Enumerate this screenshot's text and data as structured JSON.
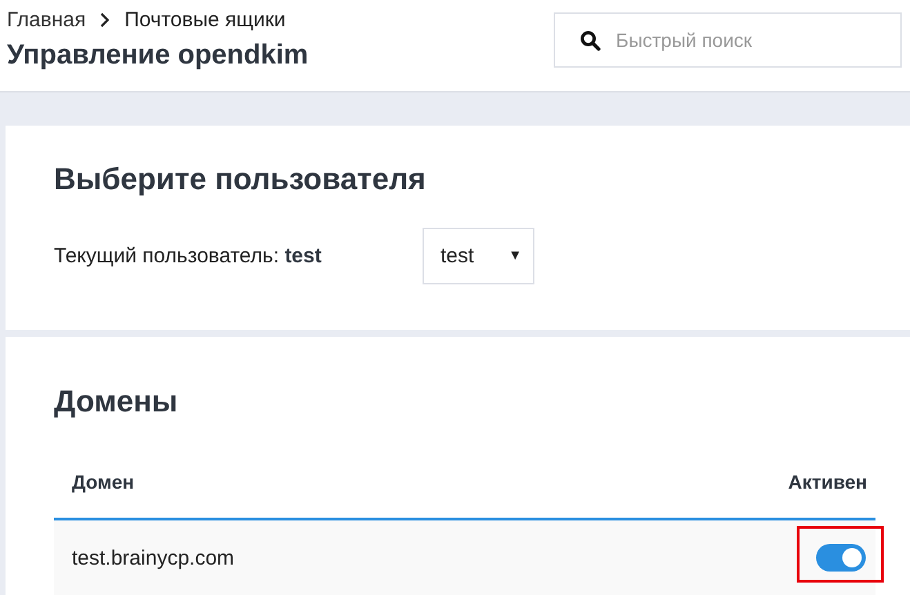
{
  "breadcrumbs": [
    {
      "label": "Главная"
    },
    {
      "label": "Почтовые ящики"
    }
  ],
  "page_title": "Управление opendkim",
  "search": {
    "placeholder": "Быстрый поиск"
  },
  "user_card": {
    "title": "Выберите пользователя",
    "current_label": "Текущий пользователь: **test**",
    "select_value": "test",
    "select_caret": "▼"
  },
  "domains_card": {
    "title": "Домены",
    "columns": [
      "Домен",
      "Активен"
    ],
    "rows": [
      {
        "domain": "test.brainycp.com",
        "active": true,
        "highlighted": true
      }
    ]
  }
}
